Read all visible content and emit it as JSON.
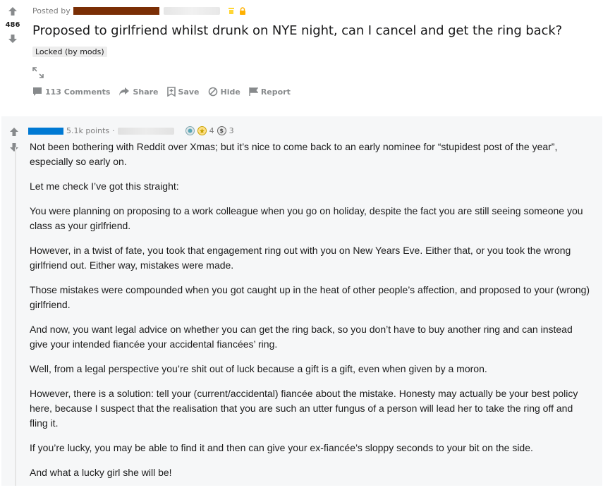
{
  "post": {
    "posted_by_label": "Posted by",
    "vote_count": "486",
    "title": "Proposed to girlfriend whilst drunk on NYE night, can I cancel and get the ring back?",
    "flair": "Locked (by mods)",
    "actions": {
      "comments": "113 Comments",
      "share": "Share",
      "save": "Save",
      "hide": "Hide",
      "report": "Report"
    }
  },
  "comment": {
    "points": "5.1k points",
    "dot": "·",
    "award_count_1": "4",
    "award_count_2": "3",
    "paragraphs": [
      "Not been bothering with Reddit over Xmas; but it’s nice to come back to an early nominee for “stupidest post of the year”, especially so early on.",
      "Let me check I’ve got this straight:",
      "You were planning on proposing to a work colleague when you go on holiday, despite the fact you are still seeing someone you class as your girlfriend.",
      "However, in a twist of fate, you took that engagement ring out with you on New Years Eve. Either that, or you took the wrong girlfriend out. Either way, mistakes were made.",
      "Those mistakes were compounded when you got caught up in the heat of other people’s affection, and proposed to your (wrong) girlfriend.",
      "And now, you want legal advice on whether you can get the ring back, so you don’t have to buy another ring and can instead give your intended fiancée your accidental fiancées’ ring.",
      "Well, from a legal perspective you’re shit out of luck because a gift is a gift, even when given by a moron.",
      "However, there is a solution: tell your (current/accidental) fiancée about the mistake. Honesty may actually be your best policy here, because I suspect that the realisation that you are such an utter fungus of a person will lead her to take the ring off and fling it.",
      "If you’re lucky, you may be able to find it and then can give your ex-fiancée’s sloppy seconds to your bit on the side.",
      "And what a lucky girl she will be!"
    ]
  },
  "colors": {
    "redacted_user": "#7a2e05",
    "commenter_bar": "#0079d3",
    "mod_icon": "#ffd635",
    "lock_icon": "#ffb000",
    "muted": "#878a8c"
  }
}
